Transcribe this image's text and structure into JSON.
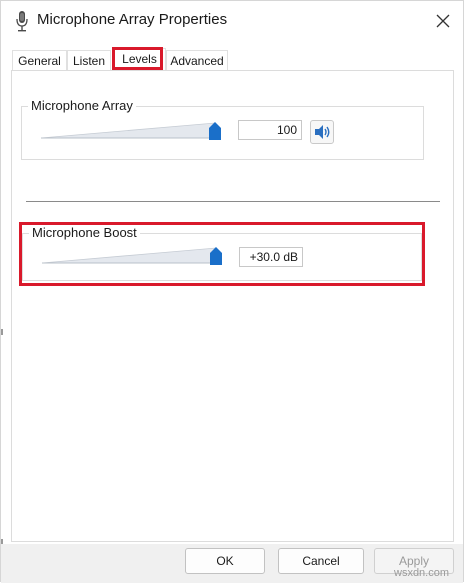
{
  "window": {
    "title": "Microphone Array Properties",
    "icons": {
      "app": "microphone-icon",
      "close": "close-icon"
    }
  },
  "tabs": [
    {
      "label": "General",
      "active": false
    },
    {
      "label": "Listen",
      "active": false
    },
    {
      "label": "Levels",
      "active": true
    },
    {
      "label": "Advanced",
      "active": false
    }
  ],
  "levels": {
    "microphone_array": {
      "label": "Microphone Array",
      "value": "100",
      "slider_fraction": 1.0,
      "speaker_icon": "speaker-icon"
    },
    "microphone_boost": {
      "label": "Microphone Boost",
      "value": "+30.0 dB",
      "slider_fraction": 1.0
    }
  },
  "buttons": {
    "ok": "OK",
    "cancel": "Cancel",
    "apply": "Apply"
  },
  "watermark": "wsxdn.com",
  "colors": {
    "highlight": "#d9192b",
    "slider_thumb": "#1a6fc9",
    "window_bg": "#ffffff",
    "bottom_bar_bg": "#f0f0f0"
  }
}
